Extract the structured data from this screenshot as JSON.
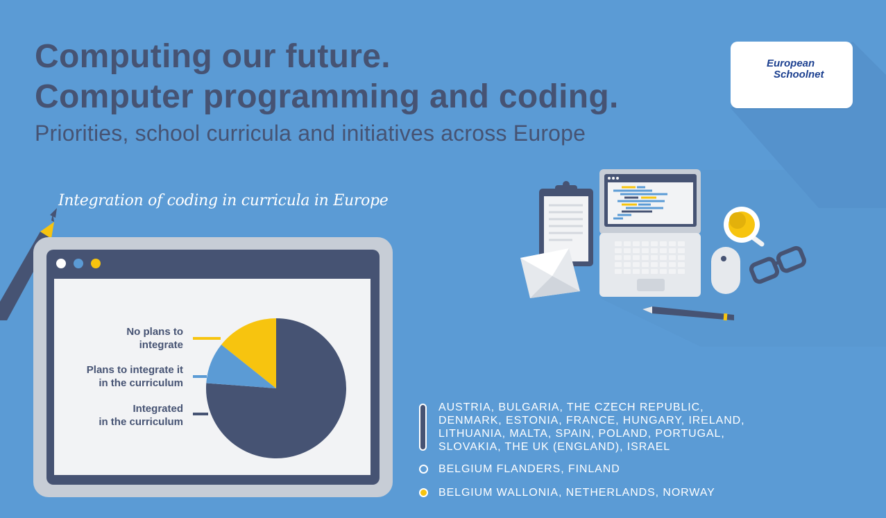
{
  "header": {
    "title_line1": "Computing our future.",
    "title_line2": "Computer programming and coding.",
    "subtitle": "Priorities, school curricula and initiatives across Europe"
  },
  "logo": {
    "line1": "European",
    "line2": "Schoolnet"
  },
  "chart_caption": "Integration of coding in curricula in Europe",
  "colors": {
    "background": "#5b9bd5",
    "dark": "#465373",
    "yellow": "#f7c40f",
    "light_blue": "#5b9bd5",
    "white": "#ffffff"
  },
  "chart_data": {
    "type": "pie",
    "title": "Integration of coding in curricula in Europe",
    "slices": [
      {
        "label": "Integrated in the curriculum",
        "label_lines": [
          "Integrated",
          "in the curriculum"
        ],
        "value": 16,
        "color": "#465373"
      },
      {
        "label": "Plans to integrate it in the curriculum",
        "label_lines": [
          "Plans to integrate it",
          "in the curriculum"
        ],
        "value": 2,
        "color": "#5b9bd5"
      },
      {
        "label": "No plans to integrate",
        "label_lines": [
          "No plans to",
          "integrate"
        ],
        "value": 3,
        "color": "#f7c40f"
      }
    ]
  },
  "legend": [
    {
      "kind": "bar",
      "color": "#465373",
      "lines": [
        "AUSTRIA, BULGARIA, THE CZECH REPUBLIC,",
        "DENMARK, ESTONIA, FRANCE, HUNGARY, IRELAND,",
        "LITHUANIA, MALTA, SPAIN, POLAND, PORTUGAL,",
        "SLOVAKIA, THE UK (ENGLAND), ISRAEL"
      ]
    },
    {
      "kind": "dot",
      "color": "#5b9bd5",
      "lines": [
        "BELGIUM FLANDERS, FINLAND"
      ]
    },
    {
      "kind": "dot",
      "color": "#f7c40f",
      "lines": [
        "BELGIUM WALLONIA, NETHERLANDS, NORWAY"
      ]
    }
  ]
}
